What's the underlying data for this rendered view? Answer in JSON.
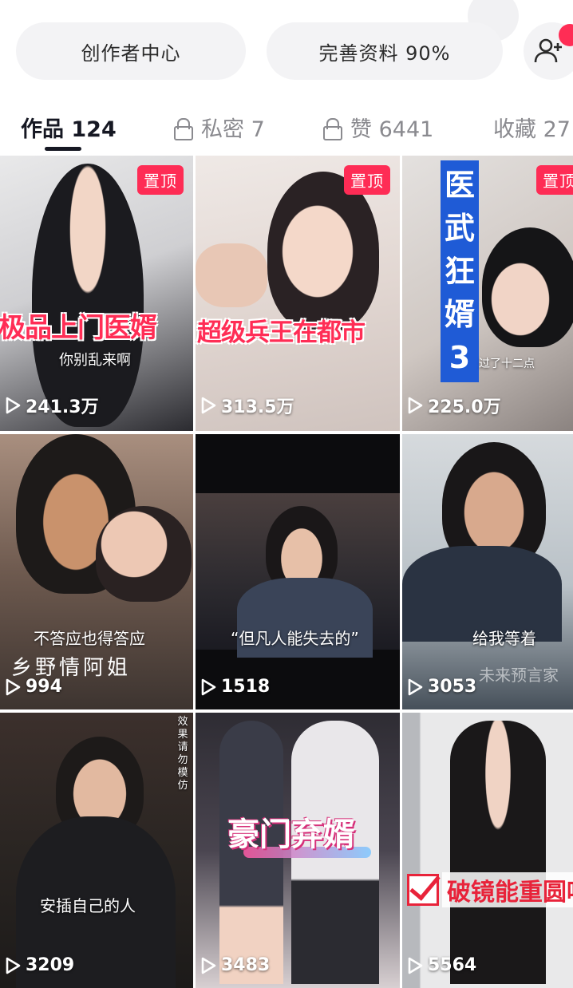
{
  "header": {
    "creator_center": "创作者中心",
    "complete_profile": "完善资料 90%"
  },
  "tabs": [
    {
      "label": "作品 124",
      "active": true
    },
    {
      "label": "私密 7",
      "locked": true
    },
    {
      "label": "赞 6441",
      "locked": true
    },
    {
      "label": "收藏 27"
    }
  ],
  "colors": {
    "accent": "#fe2c55",
    "text_primary": "#161823",
    "text_secondary": "#8a8a8f"
  },
  "videos": [
    {
      "pinned": true,
      "pin_label": "置顶",
      "title": "极品上门医婿",
      "caption": "你别乱来啊",
      "views": "241.3万"
    },
    {
      "pinned": true,
      "pin_label": "置顶",
      "title": "超级兵王在都市",
      "views": "313.5万"
    },
    {
      "pinned": true,
      "pin_label": "置顶",
      "title": "医武狂婿3",
      "caption": "过了十二点",
      "views": "225.0万"
    },
    {
      "title": "乡野情阿姐",
      "caption": "不答应也得答应",
      "views": "994"
    },
    {
      "caption": "“但凡人能失去的”",
      "views": "1518"
    },
    {
      "caption": "给我等着",
      "watermark": "未来预言家",
      "views": "3053"
    },
    {
      "side_text": "效果请勿模仿",
      "caption": "安插自己的人",
      "views": "3209"
    },
    {
      "title": "豪门弃婿",
      "views": "3483"
    },
    {
      "title": "破镜能重圆吗",
      "views": "5564"
    }
  ]
}
